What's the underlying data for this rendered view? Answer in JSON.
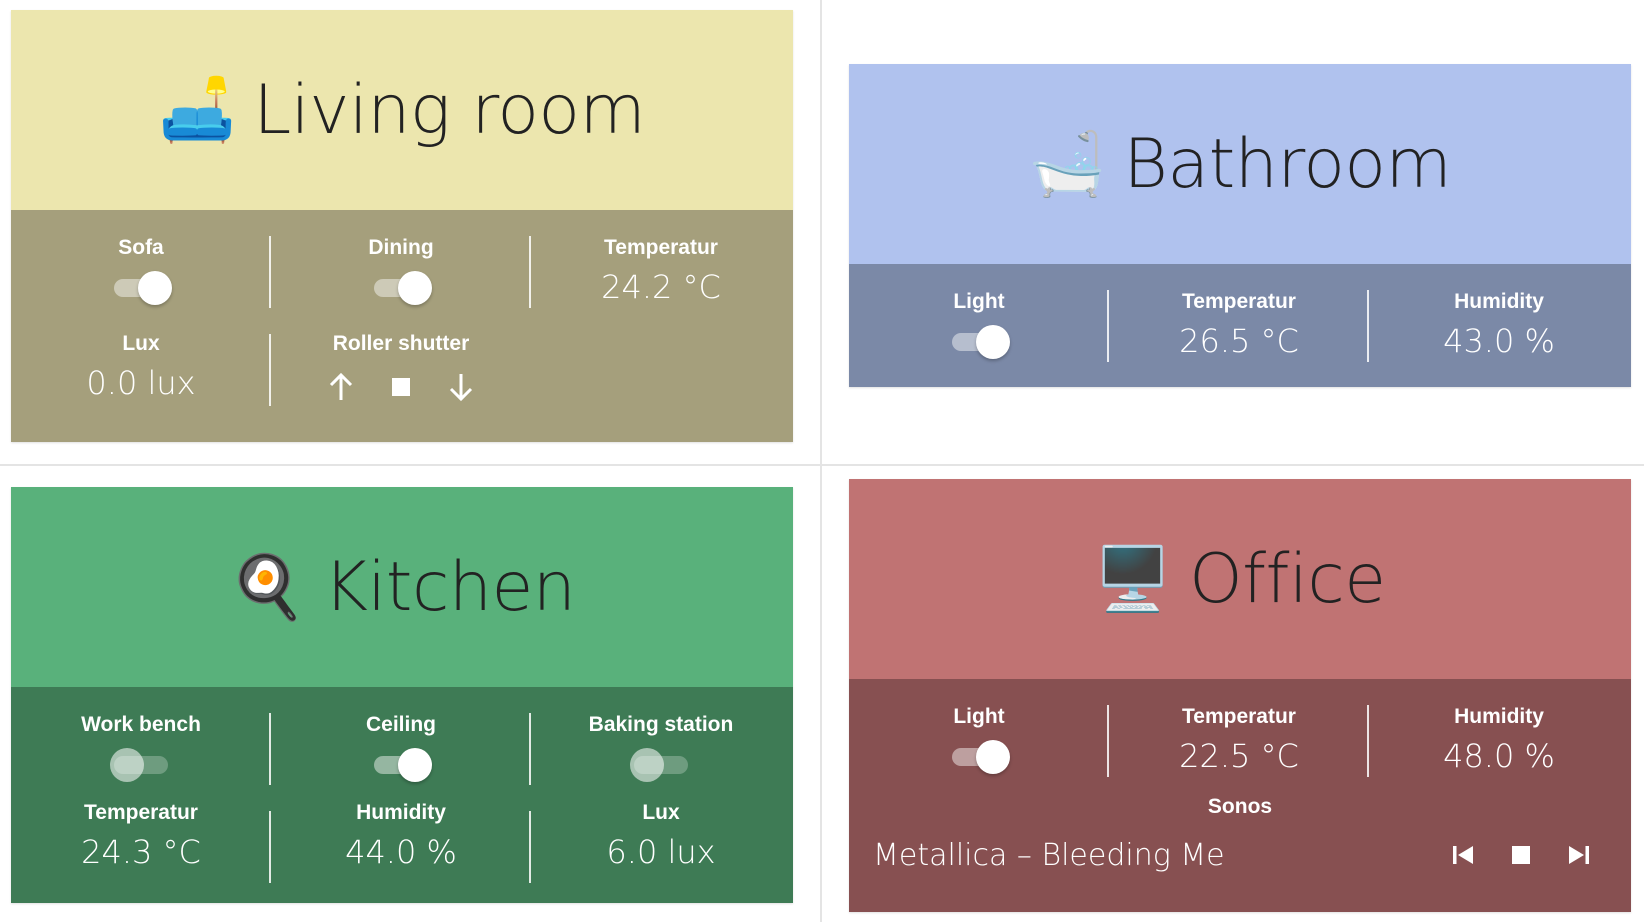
{
  "cards": {
    "living": {
      "title": "Living room",
      "emoji": "🛋️",
      "header_color": "#ece6ae",
      "body_color": "#a59f7c",
      "sofa": {
        "label": "Sofa",
        "state": "on"
      },
      "dining": {
        "label": "Dining",
        "state": "on"
      },
      "temperature": {
        "label": "Temperatur",
        "value": "24.2 °C"
      },
      "lux": {
        "label": "Lux",
        "value": "0.0 lux"
      },
      "shutter": {
        "label": "Roller shutter",
        "icons": [
          "arrow-up-icon",
          "stop-icon",
          "arrow-down-icon"
        ]
      }
    },
    "bathroom": {
      "title": "Bathroom",
      "emoji": "🛁",
      "header_color": "#b0c2ee",
      "body_color": "#7b89a7",
      "light": {
        "label": "Light",
        "state": "on"
      },
      "temperature": {
        "label": "Temperatur",
        "value": "26.5 °C"
      },
      "humidity": {
        "label": "Humidity",
        "value": "43.0 %"
      }
    },
    "kitchen": {
      "title": "Kitchen",
      "emoji": "🍳",
      "header_color": "#59b17b",
      "body_color": "#3e7b55",
      "work_bench": {
        "label": "Work bench",
        "state": "off"
      },
      "ceiling": {
        "label": "Ceiling",
        "state": "on"
      },
      "baking_station": {
        "label": "Baking station",
        "state": "off"
      },
      "temperature": {
        "label": "Temperatur",
        "value": "24.3 °C"
      },
      "humidity": {
        "label": "Humidity",
        "value": "44.0 %"
      },
      "lux": {
        "label": "Lux",
        "value": "6.0 lux"
      }
    },
    "office": {
      "title": "Office",
      "emoji": "🖥️",
      "header_color": "#c07373",
      "body_color": "#875051",
      "light": {
        "label": "Light",
        "state": "on"
      },
      "temperature": {
        "label": "Temperatur",
        "value": "22.5 °C"
      },
      "humidity": {
        "label": "Humidity",
        "value": "48.0 %"
      },
      "sonos": {
        "label": "Sonos",
        "now_playing": "Metallica – Bleeding Me",
        "icons": [
          "skip-previous-icon",
          "stop-icon",
          "skip-next-icon"
        ]
      }
    }
  }
}
